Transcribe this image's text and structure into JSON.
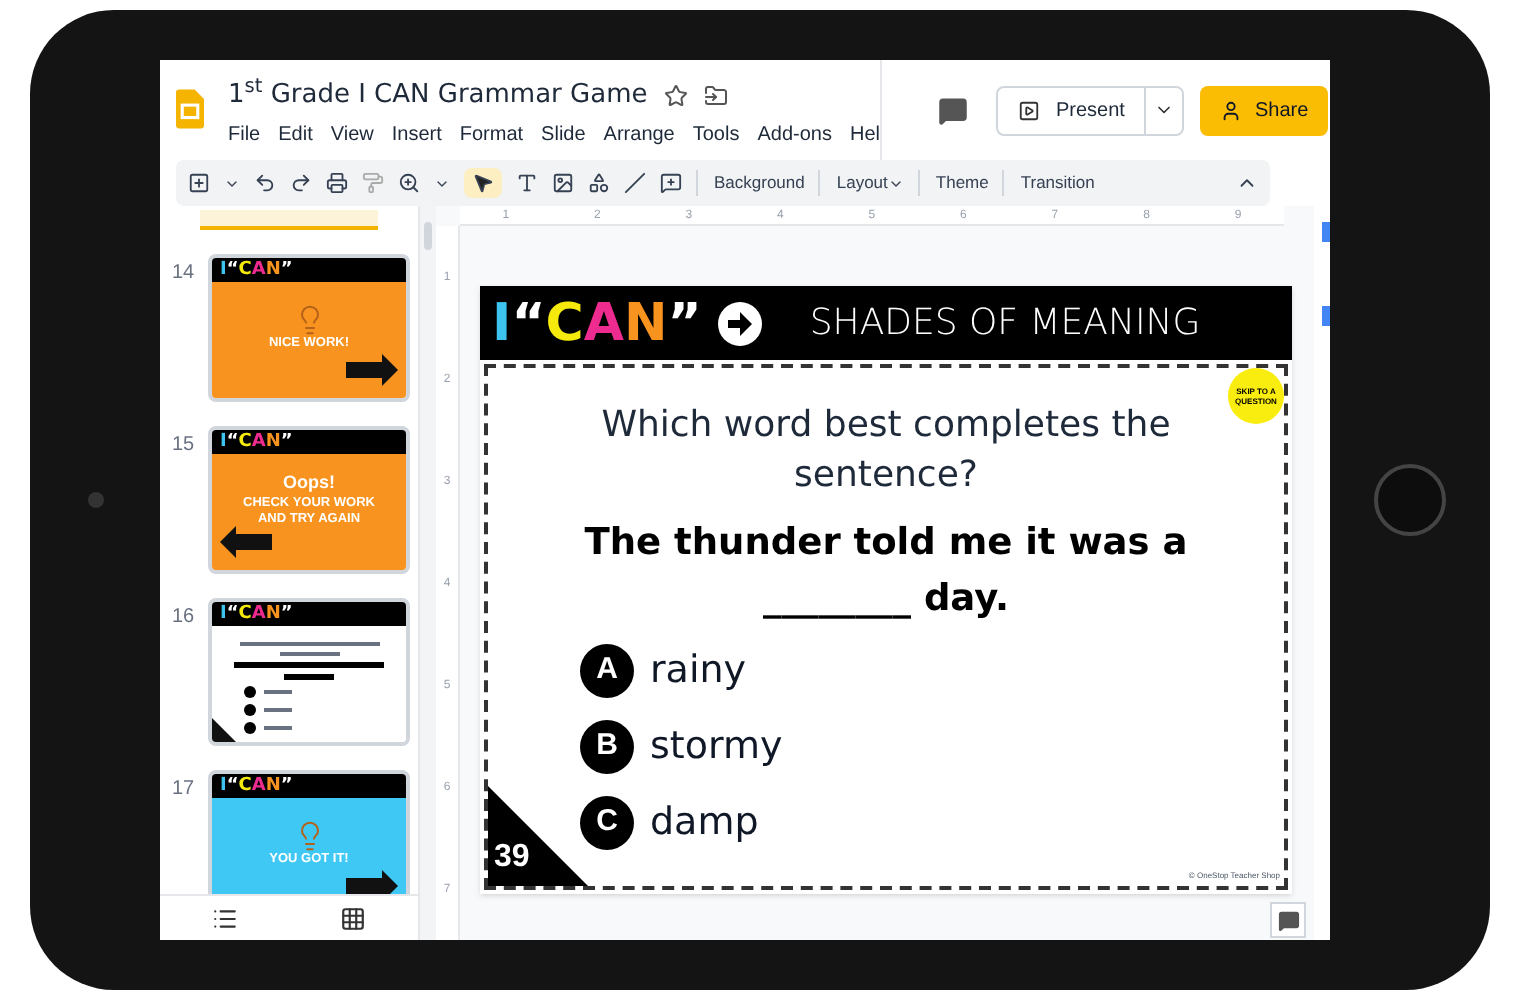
{
  "document": {
    "title": "1$^{st}$ Grade I CAN Grammar Game",
    "menu": [
      "File",
      "Edit",
      "View",
      "Insert",
      "Format",
      "Slide",
      "Arrange",
      "Tools",
      "Add-ons",
      "Hel"
    ]
  },
  "header": {
    "present": "Present",
    "share": "Share"
  },
  "toolbar": {
    "buttons": [
      {
        "label": "Background",
        "caret": false
      },
      {
        "label": "Layout",
        "caret": true
      },
      {
        "label": "Theme",
        "caret": false
      },
      {
        "label": "Transition",
        "caret": false
      }
    ]
  },
  "ruler": {
    "horizontal": [
      "1",
      "2",
      "3",
      "4",
      "5",
      "6",
      "7",
      "8",
      "9"
    ],
    "vertical": [
      "1",
      "2",
      "3",
      "4",
      "5",
      "6",
      "7"
    ]
  },
  "filmstrip": [
    {
      "number": "14",
      "kind": "correct",
      "color": "#f7931e",
      "message": "NICE WORK!",
      "logo": [
        {
          "text": "I",
          "color": "#3cc3ee"
        },
        {
          "text": "“",
          "color": "#ffffff"
        },
        {
          "text": "C",
          "color": "#f6ea0c"
        },
        {
          "text": "A",
          "color": "#ee2c8f"
        },
        {
          "text": "N",
          "color": "#f7931e"
        },
        {
          "text": "”",
          "color": "#ffffff"
        }
      ]
    },
    {
      "number": "15",
      "kind": "incorrect",
      "color": "#f7931e",
      "heading": "Oops!",
      "message": "CHECK YOUR WORK AND TRY AGAIN",
      "logo": [
        {
          "text": "I",
          "color": "#3cc3ee"
        },
        {
          "text": "“",
          "color": "#ffffff"
        },
        {
          "text": "C",
          "color": "#f6ea0c"
        },
        {
          "text": "A",
          "color": "#ee2c8f"
        },
        {
          "text": "N",
          "color": "#f7931e"
        },
        {
          "text": "”",
          "color": "#ffffff"
        }
      ]
    },
    {
      "number": "16",
      "kind": "question",
      "color": "#ffffff",
      "logo": [
        {
          "text": "I",
          "color": "#3cc3ee"
        },
        {
          "text": "“",
          "color": "#ffffff"
        },
        {
          "text": "C",
          "color": "#f6ea0c"
        },
        {
          "text": "A",
          "color": "#ee2c8f"
        },
        {
          "text": "N",
          "color": "#f7931e"
        },
        {
          "text": "”",
          "color": "#ffffff"
        }
      ]
    },
    {
      "number": "17",
      "kind": "correct",
      "color": "#3fc8f4",
      "message": "YOU GOT IT!",
      "logo": [
        {
          "text": "I",
          "color": "#3cc3ee"
        },
        {
          "text": "“",
          "color": "#ffffff"
        },
        {
          "text": "C",
          "color": "#f6ea0c"
        },
        {
          "text": "A",
          "color": "#ee2c8f"
        },
        {
          "text": "N",
          "color": "#f7931e"
        },
        {
          "text": "”",
          "color": "#ffffff"
        }
      ]
    }
  ],
  "slide": {
    "logo": [
      {
        "text": "I",
        "color": "#3cc3ee"
      },
      {
        "text": "“",
        "color": "#ffffff"
      },
      {
        "text": "C",
        "color": "#f6ea0c"
      },
      {
        "text": "A",
        "color": "#ee2c8f"
      },
      {
        "text": "N",
        "color": "#f7931e"
      },
      {
        "text": "”",
        "color": "#ffffff"
      }
    ],
    "title": "SHADES OF MEANING",
    "skip": "SKIP TO A QUESTION",
    "question": "Which word best completes the sentence?",
    "prompt": "The thunder told me it was a",
    "blank": "________ day.",
    "options": [
      {
        "letter": "A",
        "text": "rainy"
      },
      {
        "letter": "B",
        "text": "stormy"
      },
      {
        "letter": "C",
        "text": "damp"
      }
    ],
    "number": "39",
    "credit": "© OneStop Teacher Shop"
  }
}
